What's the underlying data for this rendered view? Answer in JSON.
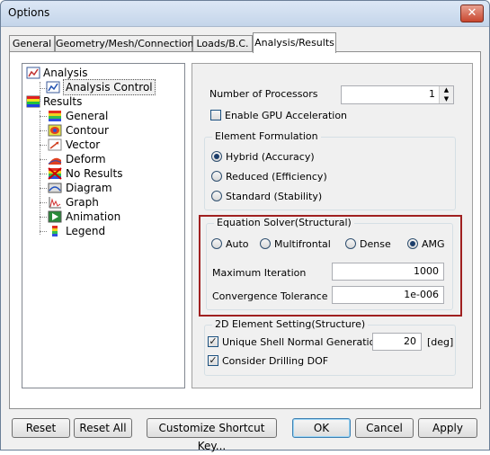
{
  "window": {
    "title": "Options",
    "close_glyph": "✕"
  },
  "tabs": [
    "General",
    "Geometry/Mesh/Connections",
    "Loads/B.C.",
    "Analysis/Results"
  ],
  "tree": {
    "analysis": "Analysis",
    "analysis_control": "Analysis Control",
    "results": "Results",
    "result_items": [
      "General",
      "Contour",
      "Vector",
      "Deform",
      "No Results",
      "Diagram",
      "Graph",
      "Animation",
      "Legend"
    ]
  },
  "settings": {
    "num_processors_label": "Number of Processors",
    "num_processors_value": "1",
    "gpu_label": "Enable GPU Acceleration",
    "element_formulation": {
      "title": "Element Formulation",
      "options": [
        "Hybrid (Accuracy)",
        "Reduced (Efficiency)",
        "Standard (Stability)"
      ],
      "selected": "Hybrid (Accuracy)"
    },
    "equation_solver": {
      "title": "Equation Solver(Structural)",
      "options": [
        "Auto",
        "Multifrontal",
        "Dense",
        "AMG"
      ],
      "selected": "AMG",
      "max_iter_label": "Maximum Iteration",
      "max_iter_value": "1000",
      "tolerance_label": "Convergence Tolerance",
      "tolerance_value": "1e-006"
    },
    "element_2d": {
      "title": "2D Element Setting(Structure)",
      "unique_shell_label": "Unique Shell Normal Generation",
      "unique_shell_value": "20",
      "unique_shell_unit": "[deg]",
      "drilling_label": "Consider Drilling DOF"
    }
  },
  "buttons": {
    "reset": "Reset",
    "reset_all": "Reset All",
    "customize": "Customize Shortcut Key...",
    "ok": "OK",
    "cancel": "Cancel",
    "apply": "Apply"
  },
  "colors": {
    "highlight_box": "#a02020",
    "title_bg": "#c4d5ea"
  }
}
